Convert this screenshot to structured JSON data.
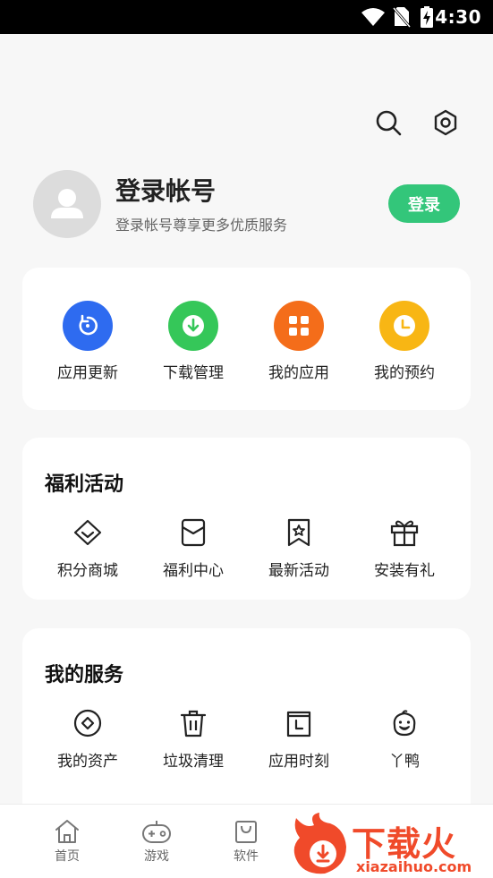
{
  "status_bar": {
    "time": "4:30"
  },
  "profile": {
    "title": "登录帐号",
    "subtitle": "登录帐号尊享更多优质服务",
    "login_label": "登录"
  },
  "quick_actions": [
    {
      "label": "应用更新",
      "icon": "refresh-icon",
      "color": "#2e6bf0"
    },
    {
      "label": "下载管理",
      "icon": "download-icon",
      "color": "#35c759"
    },
    {
      "label": "我的应用",
      "icon": "apps-grid-icon",
      "color": "#f46d1a"
    },
    {
      "label": "我的预约",
      "icon": "clock-icon",
      "color": "#f8b614"
    }
  ],
  "benefits": {
    "title": "福利活动",
    "items": [
      {
        "label": "积分商城",
        "icon": "diamond-icon"
      },
      {
        "label": "福利中心",
        "icon": "mail-box-icon"
      },
      {
        "label": "最新活动",
        "icon": "bookmark-star-icon"
      },
      {
        "label": "安装有礼",
        "icon": "gift-icon"
      }
    ]
  },
  "services": {
    "title": "我的服务",
    "items": [
      {
        "label": "我的资产",
        "icon": "coin-icon"
      },
      {
        "label": "垃圾清理",
        "icon": "trash-icon"
      },
      {
        "label": "应用时刻",
        "icon": "app-time-icon"
      },
      {
        "label": "丫鸭",
        "icon": "duck-icon"
      }
    ]
  },
  "bottom_nav": [
    {
      "label": "首页",
      "icon": "home-icon"
    },
    {
      "label": "游戏",
      "icon": "gamepad-icon"
    },
    {
      "label": "软件",
      "icon": "bag-icon"
    }
  ],
  "watermark": {
    "text": "下载火",
    "url": "xiazaihuo.com"
  }
}
